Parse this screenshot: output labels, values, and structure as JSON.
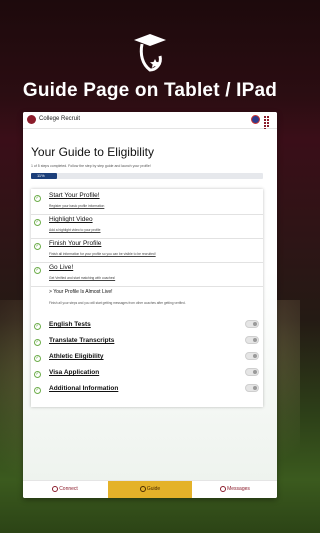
{
  "headline": "Guide Page on Tablet / IPad",
  "app": {
    "name": "College Recruit"
  },
  "guide": {
    "title": "Your Guide to Eligibility",
    "subtitle": "1 of 5 steps completed. Follow the step by step guide and launch your profile!",
    "progress_percent": 11,
    "progress_label": "11%",
    "steps": [
      {
        "title": "Start Your Profile!",
        "desc": "Register your basic profile information"
      },
      {
        "title": "Highlight Video",
        "desc": "Add a highlight video to your profile"
      },
      {
        "title": "Finish Your Profile",
        "desc": "Finish all information for your profile so you can be visible to be recruited!"
      },
      {
        "title": "Go Live!",
        "desc": "Get Verified and start matching with coaches!"
      }
    ],
    "live": {
      "title": "> Your Profile Is Almost Live!",
      "desc": "Finish all your steps and you will start getting messages from other coaches after getting verified."
    },
    "tasks": [
      {
        "label": "English Tests"
      },
      {
        "label": "Translate Transcripts"
      },
      {
        "label": "Athletic Eligibility"
      },
      {
        "label": "Visa Application"
      },
      {
        "label": "Additional Information"
      }
    ]
  },
  "bottom_nav": {
    "connect": "Connect",
    "guide": "Guide",
    "messages": "Messages"
  },
  "colors": {
    "brand": "#8b1c2b",
    "accent_gold": "#e4b229",
    "progress_blue": "#1c3f7a",
    "check_green": "#6fae4d"
  }
}
